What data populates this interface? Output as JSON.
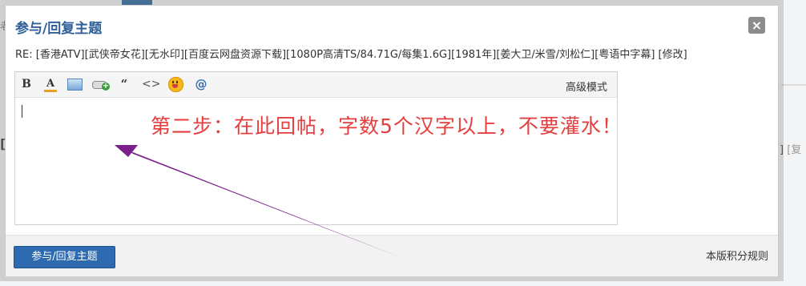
{
  "background": {
    "left_top_text": "老",
    "left_mid_text": "[",
    "right_mid_text": "] ",
    "right_mid_dim": "[复"
  },
  "dialog": {
    "title": "参与/回复主题",
    "close_symbol": "×",
    "subject_prefix": "RE: ",
    "subject": "[香港ATV][武侠帝女花][无水印][百度云网盘资源下载][1080P高清TS/84.71G/每集1.6G][1981年][姜大卫/米雪/刘松仁][粤语中字幕]",
    "edit_label": "[修改]"
  },
  "toolbar": {
    "bold": "B",
    "font_color": "A",
    "quote": "“",
    "code": "<>",
    "at": "@",
    "advanced_mode": "高级模式",
    "icons": [
      "bold-icon",
      "font-color-icon",
      "image-icon",
      "attachment-icon",
      "quote-icon",
      "code-icon",
      "smiley-icon",
      "at-icon"
    ]
  },
  "annotation": {
    "text": "第二步：在此回帖，字数5个汉字以上，不要灌水！",
    "text_color": "#e43e3e",
    "arrow_color": "#7a1f8c"
  },
  "footer": {
    "submit_label": "参与/回复主题",
    "rules_label": "本版积分规则"
  },
  "colors": {
    "title": "#30609a",
    "button": "#2e6ab0"
  }
}
